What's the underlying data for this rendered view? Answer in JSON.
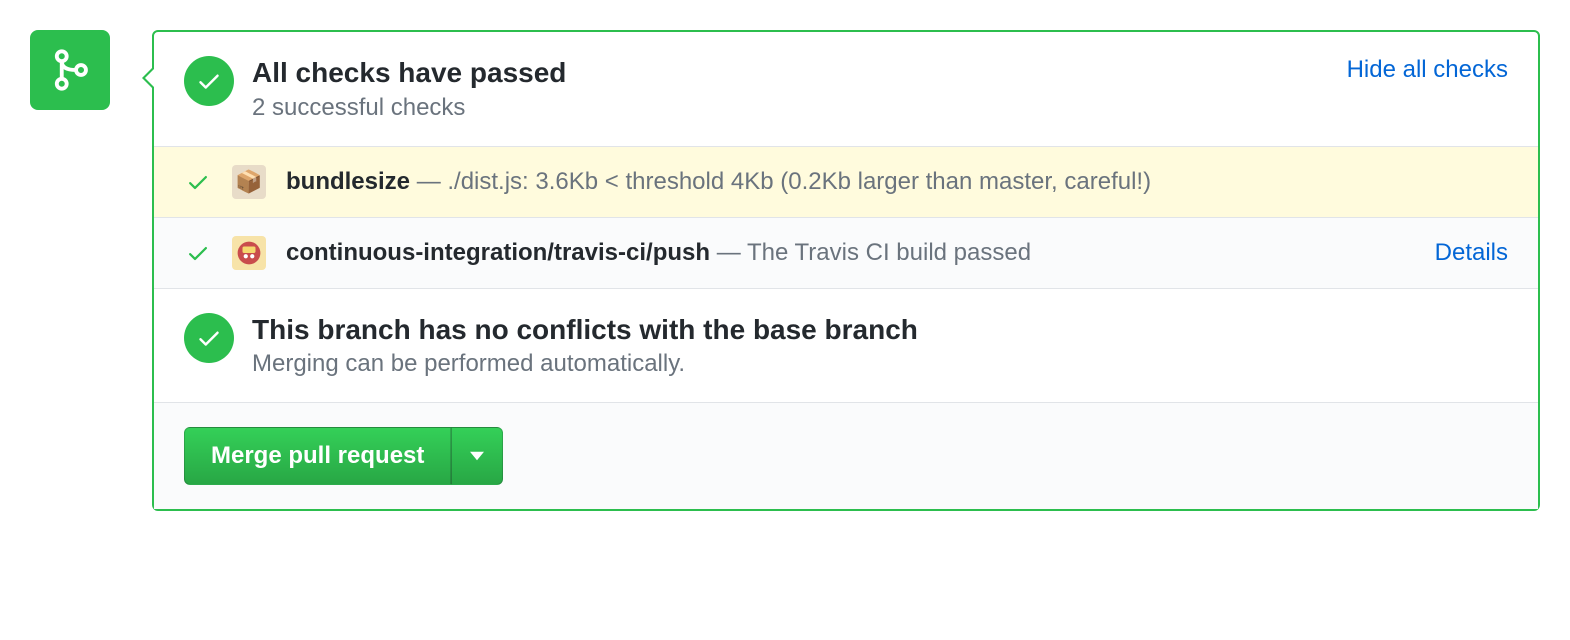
{
  "header": {
    "title": "All checks have passed",
    "subtitle": "2 successful checks",
    "hide_link": "Hide all checks"
  },
  "checks": [
    {
      "name": "bundlesize",
      "description": "./dist.js: 3.6Kb < threshold 4Kb (0.2Kb larger than master, careful!)",
      "details": "",
      "icon": "package-icon",
      "highlight": true
    },
    {
      "name": "continuous-integration/travis-ci/push",
      "description": "The Travis CI build passed",
      "details": "Details",
      "icon": "travis-icon",
      "highlight": false
    }
  ],
  "conflicts": {
    "title": "This branch has no conflicts with the base branch",
    "subtitle": "Merging can be performed automatically."
  },
  "merge": {
    "button_label": "Merge pull request"
  }
}
